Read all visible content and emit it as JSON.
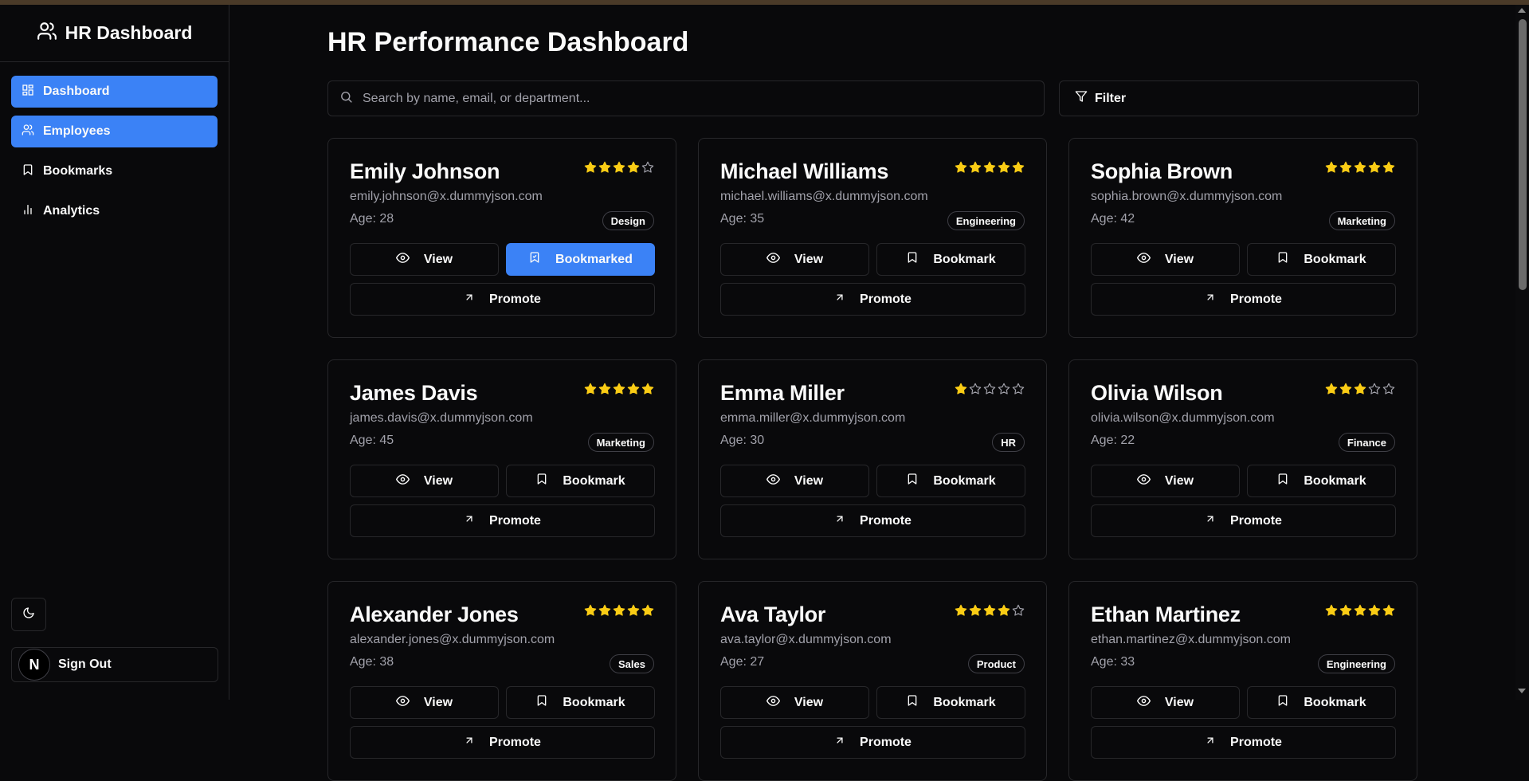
{
  "colors": {
    "accent": "#3b82f6",
    "star": "#facc15",
    "background": "#09090b",
    "border": "#27272a"
  },
  "sidebar": {
    "brand": "HR Dashboard",
    "brand_icon": "users-icon",
    "items": [
      {
        "label": "Dashboard",
        "icon": "dashboard-icon",
        "active": true
      },
      {
        "label": "Employees",
        "icon": "users-icon",
        "active": true
      },
      {
        "label": "Bookmarks",
        "icon": "bookmark-icon",
        "active": false
      },
      {
        "label": "Analytics",
        "icon": "bar-chart-icon",
        "active": false
      }
    ],
    "theme_toggle_icon": "moon-icon",
    "avatar_letter": "N",
    "signout_label": "Sign Out"
  },
  "main": {
    "title": "HR Performance Dashboard",
    "search_placeholder": "Search by name, email, or department...",
    "filter_label": "Filter",
    "view_label": "View",
    "promote_label": "Promote",
    "employees": [
      {
        "name": "Emily Johnson",
        "email": "emily.johnson@x.dummyjson.com",
        "age": "Age: 28",
        "department": "Design",
        "rating": 4,
        "bookmark_label": "Bookmarked",
        "bookmarked": true
      },
      {
        "name": "Michael Williams",
        "email": "michael.williams@x.dummyjson.com",
        "age": "Age: 35",
        "department": "Engineering",
        "rating": 5,
        "bookmark_label": "Bookmark",
        "bookmarked": false
      },
      {
        "name": "Sophia Brown",
        "email": "sophia.brown@x.dummyjson.com",
        "age": "Age: 42",
        "department": "Marketing",
        "rating": 5,
        "bookmark_label": "Bookmark",
        "bookmarked": false
      },
      {
        "name": "James Davis",
        "email": "james.davis@x.dummyjson.com",
        "age": "Age: 45",
        "department": "Marketing",
        "rating": 5,
        "bookmark_label": "Bookmark",
        "bookmarked": false
      },
      {
        "name": "Emma Miller",
        "email": "emma.miller@x.dummyjson.com",
        "age": "Age: 30",
        "department": "HR",
        "rating": 1,
        "bookmark_label": "Bookmark",
        "bookmarked": false
      },
      {
        "name": "Olivia Wilson",
        "email": "olivia.wilson@x.dummyjson.com",
        "age": "Age: 22",
        "department": "Finance",
        "rating": 3,
        "bookmark_label": "Bookmark",
        "bookmarked": false
      },
      {
        "name": "Alexander Jones",
        "email": "alexander.jones@x.dummyjson.com",
        "age": "Age: 38",
        "department": "Sales",
        "rating": 5,
        "bookmark_label": "Bookmark",
        "bookmarked": false
      },
      {
        "name": "Ava Taylor",
        "email": "ava.taylor@x.dummyjson.com",
        "age": "Age: 27",
        "department": "Product",
        "rating": 4,
        "bookmark_label": "Bookmark",
        "bookmarked": false
      },
      {
        "name": "Ethan Martinez",
        "email": "ethan.martinez@x.dummyjson.com",
        "age": "Age: 33",
        "department": "Engineering",
        "rating": 5,
        "bookmark_label": "Bookmark",
        "bookmarked": false
      }
    ]
  }
}
